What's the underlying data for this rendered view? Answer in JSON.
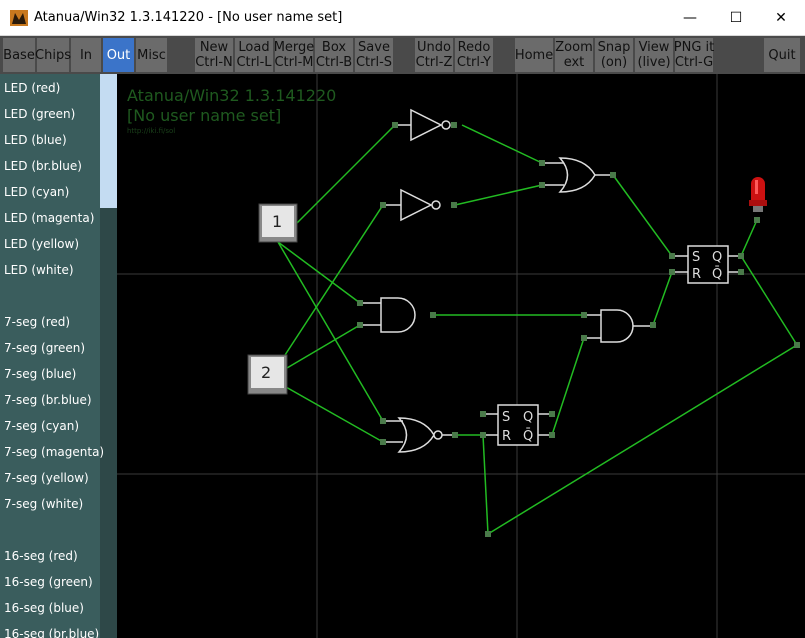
{
  "window": {
    "title": "Atanua/Win32 1.3.141220 - [No user name set]",
    "minimize_glyph": "—",
    "maximize_glyph": "☐",
    "close_glyph": "✕"
  },
  "toolbar": {
    "base": "Base",
    "chips": "Chips",
    "in": "In",
    "out": "Out",
    "misc": "Misc",
    "new_label": "New",
    "new_shortcut": "Ctrl-N",
    "load_label": "Load",
    "load_shortcut": "Ctrl-L",
    "merge_label": "Merge",
    "merge_shortcut": "Ctrl-M",
    "box_label": "Box",
    "box_shortcut": "Ctrl-B",
    "save_label": "Save",
    "save_shortcut": "Ctrl-S",
    "undo_label": "Undo",
    "undo_shortcut": "Ctrl-Z",
    "redo_label": "Redo",
    "redo_shortcut": "Ctrl-Y",
    "home": "Home",
    "zoom_label": "Zoom",
    "zoom_sub": "ext",
    "snap_label": "Snap",
    "snap_state": "(on)",
    "view_label": "View",
    "view_state": "(live)",
    "png_label": "PNG it",
    "png_shortcut": "Ctrl-G",
    "quit": "Quit"
  },
  "sidebar": {
    "items": [
      "LED (red)",
      "LED (green)",
      "LED (blue)",
      "LED (br.blue)",
      "LED (cyan)",
      "LED (magenta)",
      "LED (yellow)",
      "LED (white)",
      "7-seg (red)",
      "7-seg (green)",
      "7-seg (blue)",
      "7-seg (br.blue)",
      "7-seg (cyan)",
      "7-seg (magenta)",
      "7-seg (yellow)",
      "7-seg (white)",
      "16-seg (red)",
      "16-seg (green)",
      "16-seg (blue)",
      "16-seg (br.blue)"
    ]
  },
  "canvas": {
    "watermark_title": "Atanua/Win32 1.3.141220",
    "watermark_user": "[No user name set]",
    "watermark_url": "http://iki.fi/sol",
    "button1_label": "1",
    "button2_label": "2",
    "sr_s": "S",
    "sr_r": "R",
    "sr_q": "Q",
    "sr_qbar": "Q̄",
    "wire_color": "#22bb22",
    "led_color": "#cc1111"
  }
}
